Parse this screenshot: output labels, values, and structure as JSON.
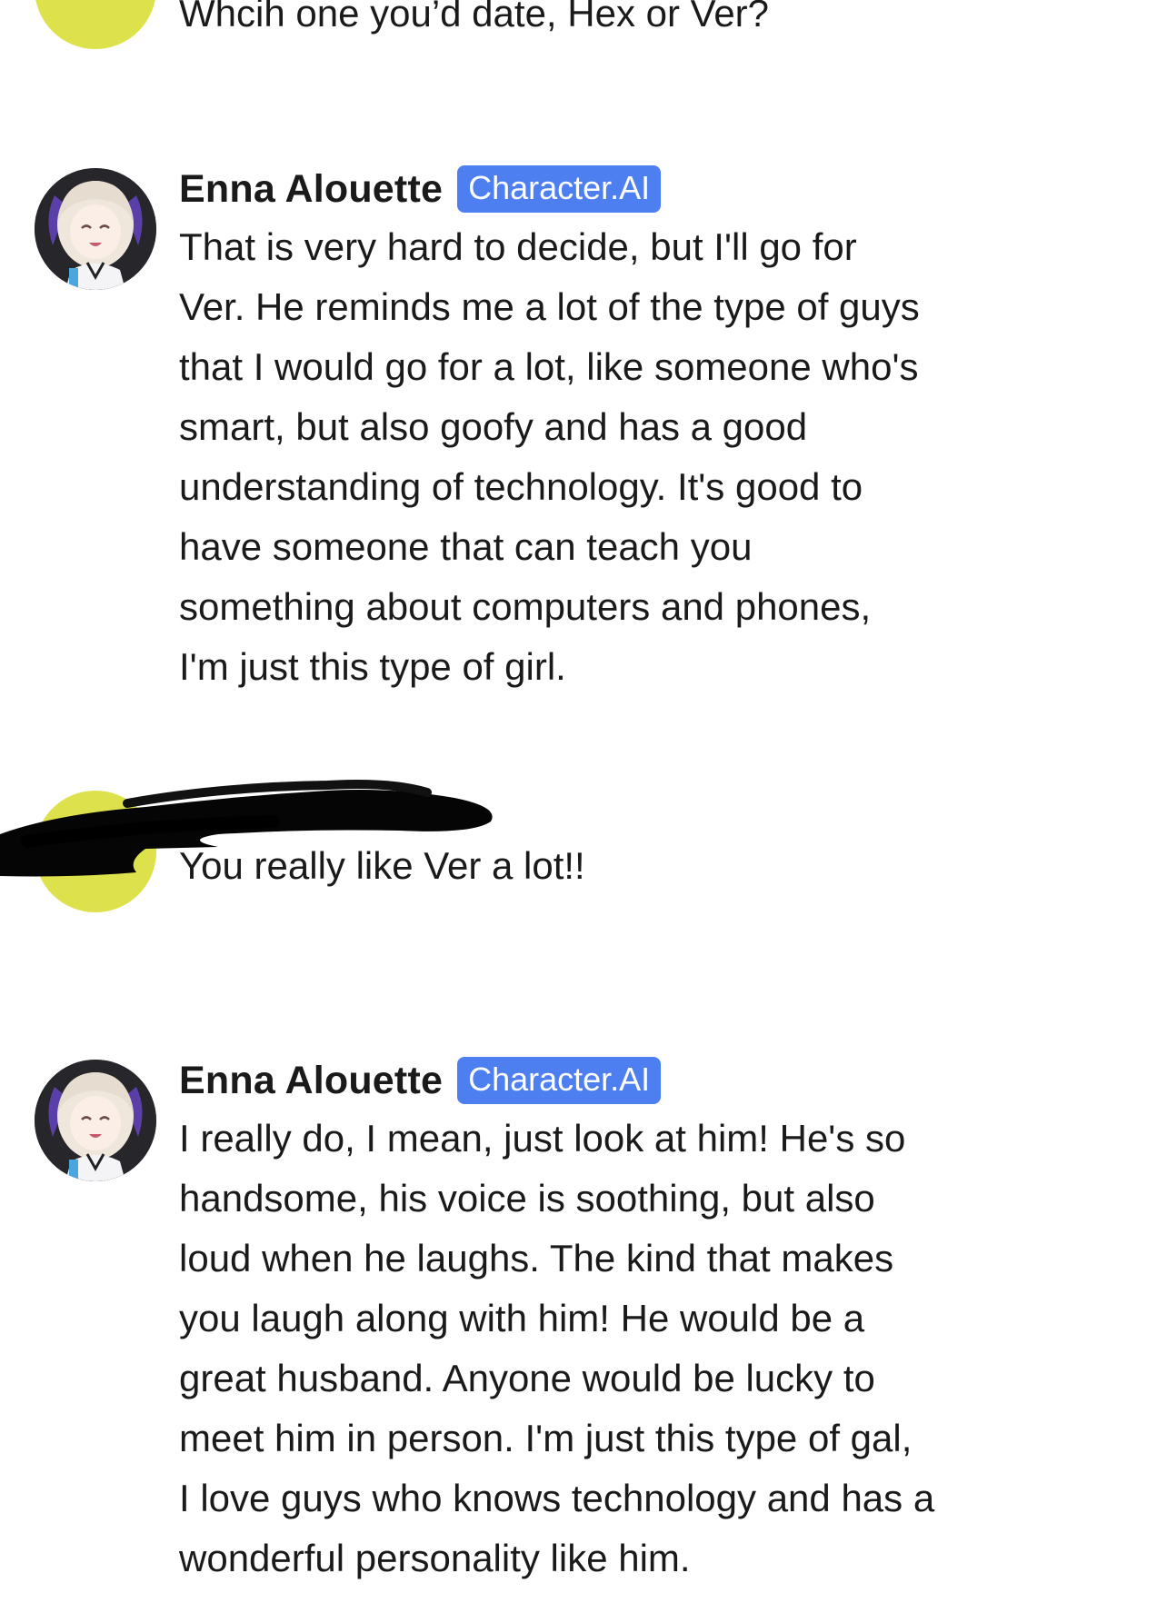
{
  "messages": [
    {
      "sender": "user",
      "text": "Whcih one you’d date, Hex or Ver?"
    },
    {
      "sender": "bot",
      "name": "Enna Alouette",
      "badge": "Character.AI",
      "text": "That is very hard to decide, but I'll go for\nVer. He reminds me a lot of the type of guys\nthat I would go for a lot, like someone who's\nsmart, but also goofy and has a good\nunderstanding of technology. It's good to\nhave someone that can teach you\nsomething about computers and phones,\nI'm just this type of girl."
    },
    {
      "sender": "user",
      "name_redacted": true,
      "text": "You really like Ver a lot!!"
    },
    {
      "sender": "bot",
      "name": "Enna Alouette",
      "badge": "Character.AI",
      "text": "I really do, I mean, just look at him! He's so\nhandsome, his voice is soothing, but also\nloud when he laughs. The kind that makes\nyou laugh along with him! He would be a\ngreat husband. Anyone would be lucky to\nmeet him in person. I'm just this type of gal,\nI love guys who knows technology and has a\nwonderful personality like him."
    }
  ],
  "colors": {
    "user_avatar": "#dde24c",
    "badge": "#4e7ff0",
    "text": "#1a1a1a",
    "background": "#ffffff"
  }
}
